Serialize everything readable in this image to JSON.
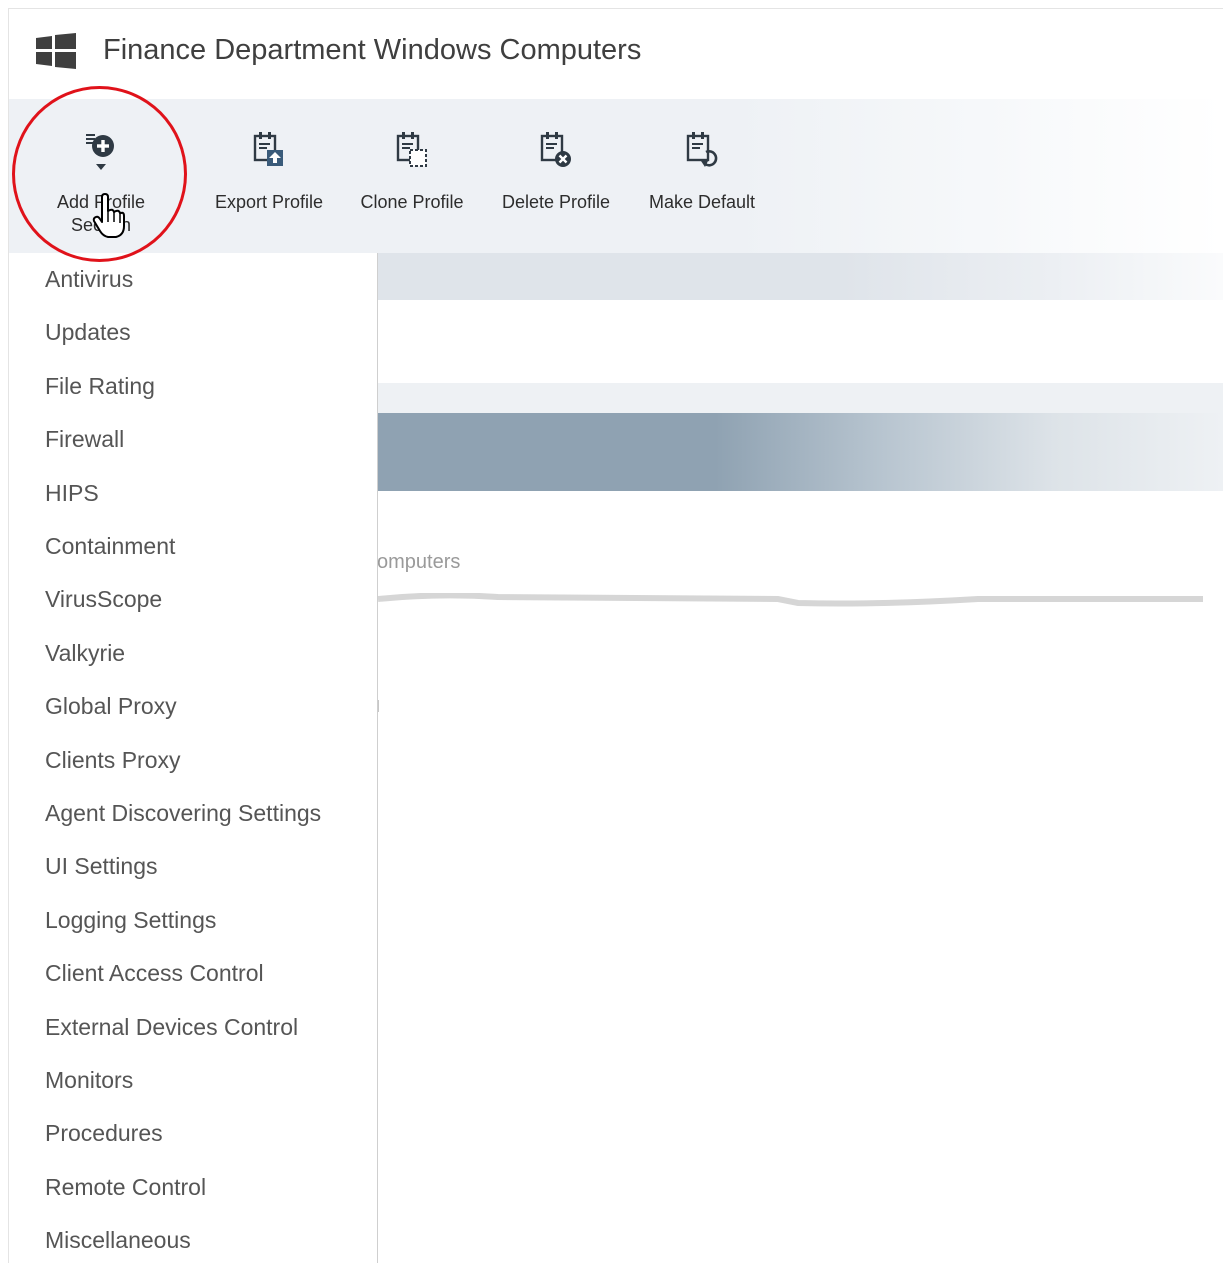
{
  "header": {
    "title": "Finance Department Windows Computers",
    "icon": "windows-logo-icon"
  },
  "toolbar": {
    "buttons": [
      {
        "label_line1": "Add Profile",
        "label_line2": "Section",
        "icon": "add-section-icon"
      },
      {
        "label": "Export Profile",
        "icon": "export-icon"
      },
      {
        "label": "Clone Profile",
        "icon": "clone-icon"
      },
      {
        "label": "Delete Profile",
        "icon": "delete-icon"
      },
      {
        "label": "Make Default",
        "icon": "make-default-icon"
      }
    ]
  },
  "section_menu": {
    "items": [
      "Antivirus",
      "Updates",
      "File Rating",
      "Firewall",
      "HIPS",
      "Containment",
      "VirusScope",
      "Valkyrie",
      "Global Proxy",
      "Clients Proxy",
      "Agent Discovering Settings",
      "UI Settings",
      "Logging Settings",
      "Client Access Control",
      "External Devices Control",
      "Monitors",
      "Procedures",
      "Remote Control",
      "Miscellaneous"
    ]
  },
  "background": {
    "partial_text": "omputers"
  },
  "colors": {
    "highlight": "#e0121a",
    "icon": "#2f3a44",
    "accent": "#3a5b7a"
  }
}
